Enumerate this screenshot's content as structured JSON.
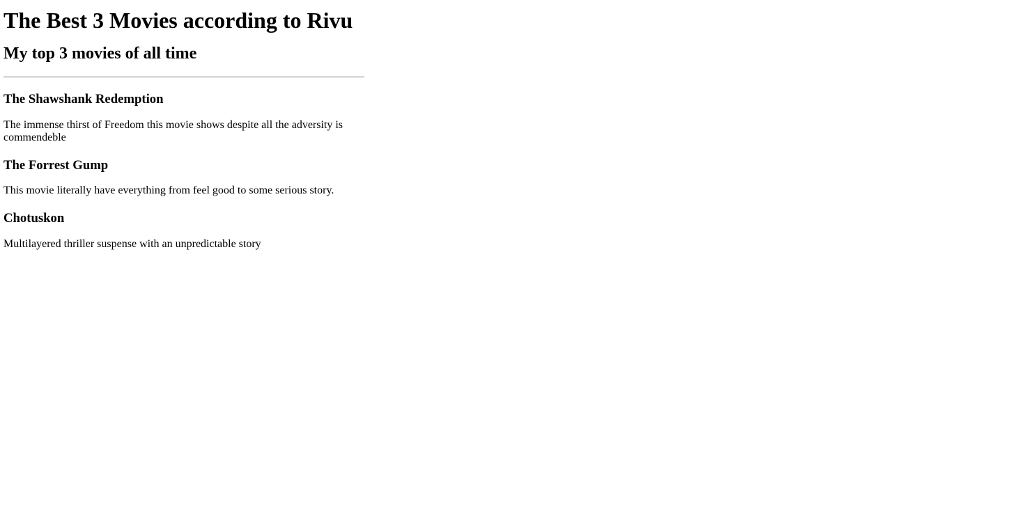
{
  "page": {
    "title": "The Best 3 Movies according to Rivu",
    "subtitle": "My top 3 movies of all time"
  },
  "movies": [
    {
      "name": "The Shawshank Redemption",
      "description": "The immense thirst of Freedom this movie shows despite all the adversity is commendeble"
    },
    {
      "name": "The Forrest Gump",
      "description": "This movie literally have everything from feel good to some serious story."
    },
    {
      "name": "Chotuskon",
      "description": "Multilayered thriller suspense with an unpredictable story"
    }
  ]
}
